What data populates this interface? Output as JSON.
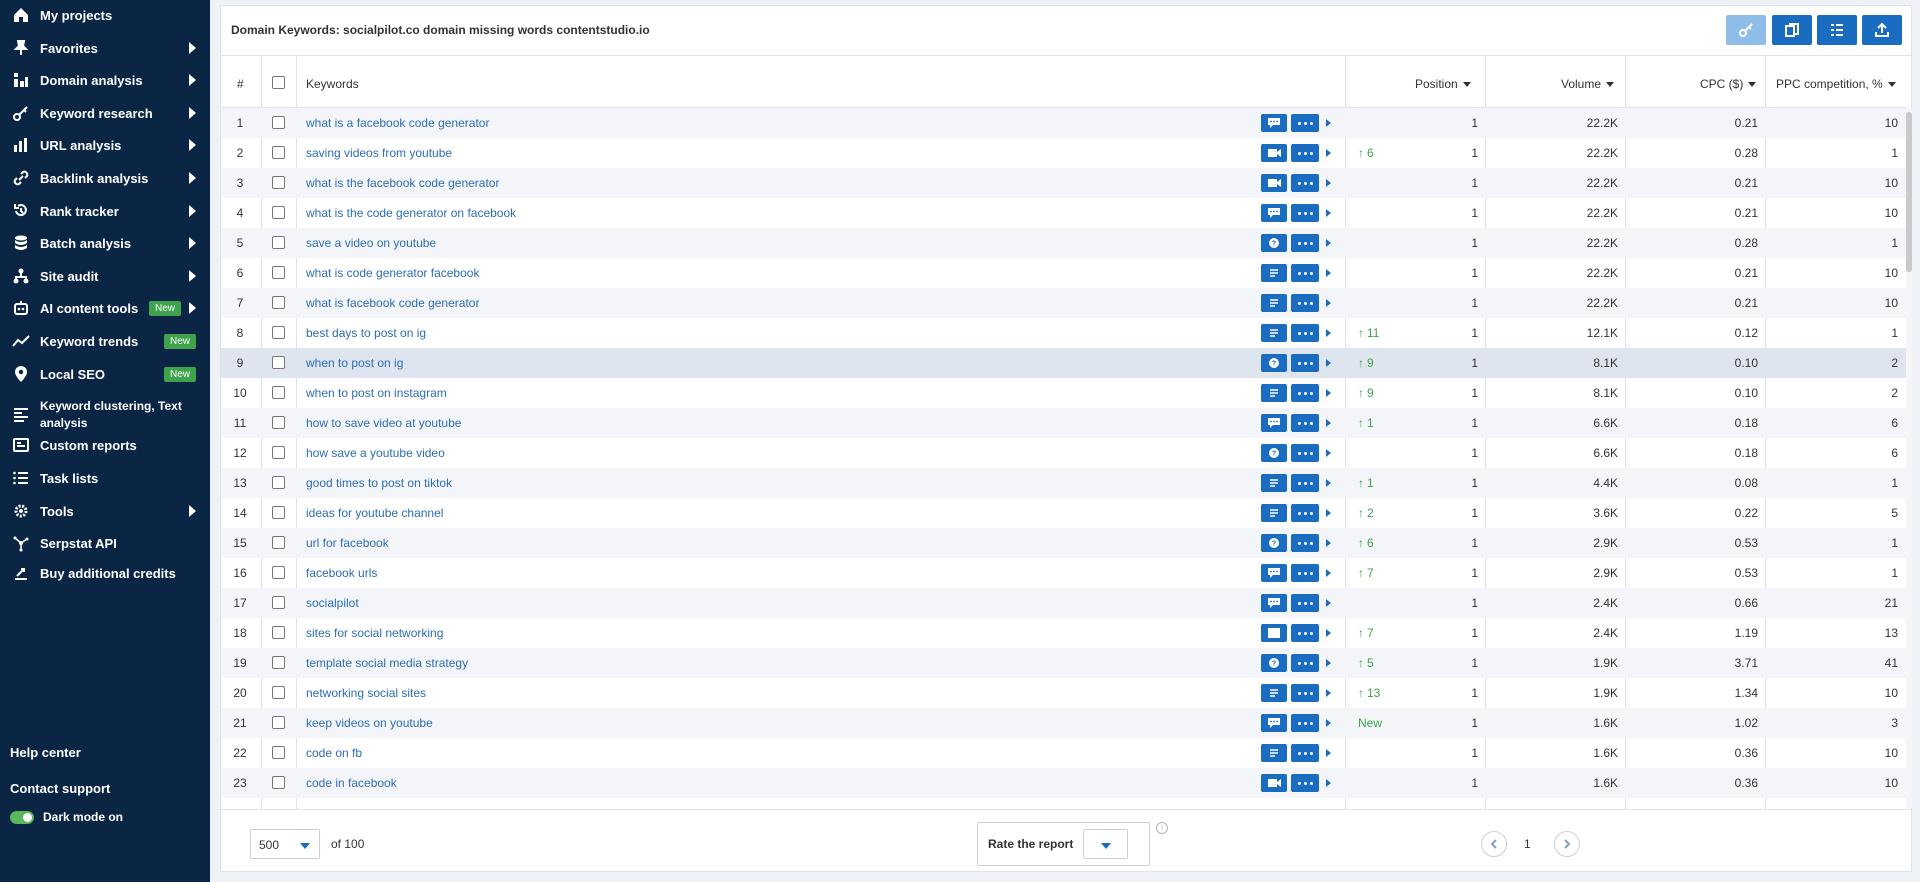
{
  "sidebar": {
    "items": [
      {
        "label": "My projects",
        "icon": "home-icon",
        "arrow": false,
        "badge": ""
      },
      {
        "label": "Favorites",
        "icon": "pin-icon",
        "arrow": true,
        "badge": ""
      },
      {
        "label": "Domain analysis",
        "icon": "domain-analysis-icon",
        "arrow": true,
        "badge": ""
      },
      {
        "label": "Keyword research",
        "icon": "key-icon",
        "arrow": true,
        "badge": ""
      },
      {
        "label": "URL analysis",
        "icon": "bar-chart-icon",
        "arrow": true,
        "badge": ""
      },
      {
        "label": "Backlink analysis",
        "icon": "link-icon",
        "arrow": true,
        "badge": ""
      },
      {
        "label": "Rank tracker",
        "icon": "history-icon",
        "arrow": true,
        "badge": ""
      },
      {
        "label": "Batch analysis",
        "icon": "database-icon",
        "arrow": true,
        "badge": ""
      },
      {
        "label": "Site audit",
        "icon": "sitemap-icon",
        "arrow": true,
        "badge": ""
      },
      {
        "label": "AI content tools",
        "icon": "robot-icon",
        "arrow": true,
        "badge": "New"
      },
      {
        "label": "Keyword trends",
        "icon": "trend-icon",
        "arrow": false,
        "badge": "New"
      },
      {
        "label": "Local SEO",
        "icon": "location-pin-icon",
        "arrow": false,
        "badge": "New"
      },
      {
        "label": "Keyword clustering, Text analysis",
        "icon": "clustering-icon",
        "arrow": false,
        "badge": ""
      },
      {
        "label": "Custom reports",
        "icon": "report-icon",
        "arrow": false,
        "badge": ""
      },
      {
        "label": "Task lists",
        "icon": "list-icon",
        "arrow": false,
        "badge": ""
      },
      {
        "label": "Tools",
        "icon": "gear-icon",
        "arrow": true,
        "badge": ""
      },
      {
        "label": "Serpstat API",
        "icon": "api-icon",
        "arrow": false,
        "badge": ""
      },
      {
        "label": "Buy additional credits",
        "icon": "credits-icon",
        "arrow": false,
        "badge": ""
      }
    ],
    "help": "Help center",
    "support": "Contact support",
    "dark_mode": "Dark mode on"
  },
  "header": {
    "title": "Domain Keywords: socialpilot.co domain missing words contentstudio.io"
  },
  "table": {
    "columns": {
      "num": "#",
      "keywords": "Keywords",
      "position": "Position",
      "volume": "Volume",
      "cpc": "CPC ($)",
      "ppc": "PPC competition, %"
    },
    "rows": [
      {
        "n": "1",
        "kw": "what is a facebook code generator",
        "feat": "reviews",
        "diff": "",
        "pos": "1",
        "vol": "22.2K",
        "cpc": "0.21",
        "ppc": "10"
      },
      {
        "n": "2",
        "kw": "saving videos from youtube",
        "feat": "video",
        "diff": "6",
        "pos": "1",
        "vol": "22.2K",
        "cpc": "0.28",
        "ppc": "1"
      },
      {
        "n": "3",
        "kw": "what is the facebook code generator",
        "feat": "video",
        "diff": "",
        "pos": "1",
        "vol": "22.2K",
        "cpc": "0.21",
        "ppc": "10"
      },
      {
        "n": "4",
        "kw": "what is the code generator on facebook",
        "feat": "reviews",
        "diff": "",
        "pos": "1",
        "vol": "22.2K",
        "cpc": "0.21",
        "ppc": "10"
      },
      {
        "n": "5",
        "kw": "save a video on youtube",
        "feat": "question",
        "diff": "",
        "pos": "1",
        "vol": "22.2K",
        "cpc": "0.28",
        "ppc": "1"
      },
      {
        "n": "6",
        "kw": "what is code generator facebook",
        "feat": "snippet",
        "diff": "",
        "pos": "1",
        "vol": "22.2K",
        "cpc": "0.21",
        "ppc": "10"
      },
      {
        "n": "7",
        "kw": "what is facebook code generator",
        "feat": "snippet",
        "diff": "",
        "pos": "1",
        "vol": "22.2K",
        "cpc": "0.21",
        "ppc": "10"
      },
      {
        "n": "8",
        "kw": "best days to post on ig",
        "feat": "snippet",
        "diff": "11",
        "pos": "1",
        "vol": "12.1K",
        "cpc": "0.12",
        "ppc": "1"
      },
      {
        "n": "9",
        "kw": "when to post on ig",
        "feat": "question",
        "diff": "9",
        "pos": "1",
        "vol": "8.1K",
        "cpc": "0.10",
        "ppc": "2"
      },
      {
        "n": "10",
        "kw": "when to post on instagram",
        "feat": "snippet",
        "diff": "9",
        "pos": "1",
        "vol": "8.1K",
        "cpc": "0.10",
        "ppc": "2"
      },
      {
        "n": "11",
        "kw": "how to save video at youtube",
        "feat": "reviews",
        "diff": "1",
        "pos": "1",
        "vol": "6.6K",
        "cpc": "0.18",
        "ppc": "6"
      },
      {
        "n": "12",
        "kw": "how save a youtube video",
        "feat": "question",
        "diff": "",
        "pos": "1",
        "vol": "6.6K",
        "cpc": "0.18",
        "ppc": "6"
      },
      {
        "n": "13",
        "kw": "good times to post on tiktok",
        "feat": "snippet",
        "diff": "1",
        "pos": "1",
        "vol": "4.4K",
        "cpc": "0.08",
        "ppc": "1"
      },
      {
        "n": "14",
        "kw": "ideas for youtube channel",
        "feat": "snippet",
        "diff": "2",
        "pos": "1",
        "vol": "3.6K",
        "cpc": "0.22",
        "ppc": "5"
      },
      {
        "n": "15",
        "kw": "url for facebook",
        "feat": "question",
        "diff": "6",
        "pos": "1",
        "vol": "2.9K",
        "cpc": "0.53",
        "ppc": "1"
      },
      {
        "n": "16",
        "kw": "facebook urls",
        "feat": "reviews",
        "diff": "7",
        "pos": "1",
        "vol": "2.9K",
        "cpc": "0.53",
        "ppc": "1"
      },
      {
        "n": "17",
        "kw": "socialpilot",
        "feat": "reviews",
        "diff": "",
        "pos": "1",
        "vol": "2.4K",
        "cpc": "0.66",
        "ppc": "21"
      },
      {
        "n": "18",
        "kw": "sites for social networking",
        "feat": "image",
        "diff": "7",
        "pos": "1",
        "vol": "2.4K",
        "cpc": "1.19",
        "ppc": "13"
      },
      {
        "n": "19",
        "kw": "template social media strategy",
        "feat": "question",
        "diff": "5",
        "pos": "1",
        "vol": "1.9K",
        "cpc": "3.71",
        "ppc": "41"
      },
      {
        "n": "20",
        "kw": "networking social sites",
        "feat": "snippet",
        "diff": "13",
        "pos": "1",
        "vol": "1.9K",
        "cpc": "1.34",
        "ppc": "10"
      },
      {
        "n": "21",
        "kw": "keep videos on youtube",
        "feat": "reviews",
        "diff": "New",
        "pos": "1",
        "vol": "1.6K",
        "cpc": "1.02",
        "ppc": "3"
      },
      {
        "n": "22",
        "kw": "code on fb",
        "feat": "snippet",
        "diff": "",
        "pos": "1",
        "vol": "1.6K",
        "cpc": "0.36",
        "ppc": "10"
      },
      {
        "n": "23",
        "kw": "code in facebook",
        "feat": "video",
        "diff": "",
        "pos": "1",
        "vol": "1.6K",
        "cpc": "0.36",
        "ppc": "10"
      }
    ]
  },
  "footer": {
    "page_size": "500",
    "of_label": "of 100",
    "rate_label": "Rate the report",
    "page": "1"
  },
  "colors": {
    "sidebar_bg": "#0b2545",
    "accent": "#1a6cc1",
    "link": "#2d6db4",
    "positive": "#3fa34d"
  }
}
